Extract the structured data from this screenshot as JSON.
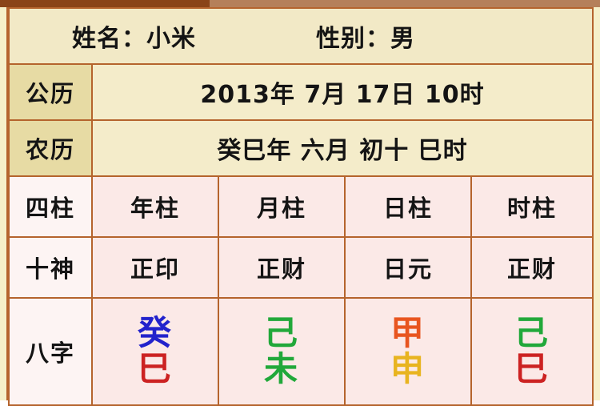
{
  "decor": {
    "topbar_left_color": "#8a4418",
    "topbar_right_color": "#b5805a",
    "border_color": "#b5642d",
    "tan_label_bg": "#e7dba4",
    "tan_value_bg": "#f4ecca",
    "pink_label_bg": "#fdf4f3",
    "pink_value_bg": "#fbe9e7"
  },
  "header": {
    "name_field": "姓名：小米",
    "gender_field": "性别：男"
  },
  "dates": [
    {
      "label": "公历",
      "value": "2013年 7月 17日 10时"
    },
    {
      "label": "农历",
      "value": "癸巳年 六月 初十 巳时"
    }
  ],
  "pillars": {
    "sizhu_label": "四柱",
    "sizhu_values": [
      "年柱",
      "月柱",
      "日柱",
      "时柱"
    ],
    "shishen_label": "十神",
    "shishen_values": [
      "正印",
      "正财",
      "日元",
      "正财"
    ],
    "bazi_label": "八字",
    "bazi_values": [
      {
        "stem": "癸",
        "stem_color": "#2222cc",
        "branch": "巳",
        "branch_color": "#cc2222"
      },
      {
        "stem": "己",
        "stem_color": "#21a83a",
        "branch": "未",
        "branch_color": "#21a83a"
      },
      {
        "stem": "甲",
        "stem_color": "#e8551f",
        "branch": "申",
        "branch_color": "#e8b420"
      },
      {
        "stem": "己",
        "stem_color": "#21a83a",
        "branch": "巳",
        "branch_color": "#cc2222"
      }
    ]
  }
}
